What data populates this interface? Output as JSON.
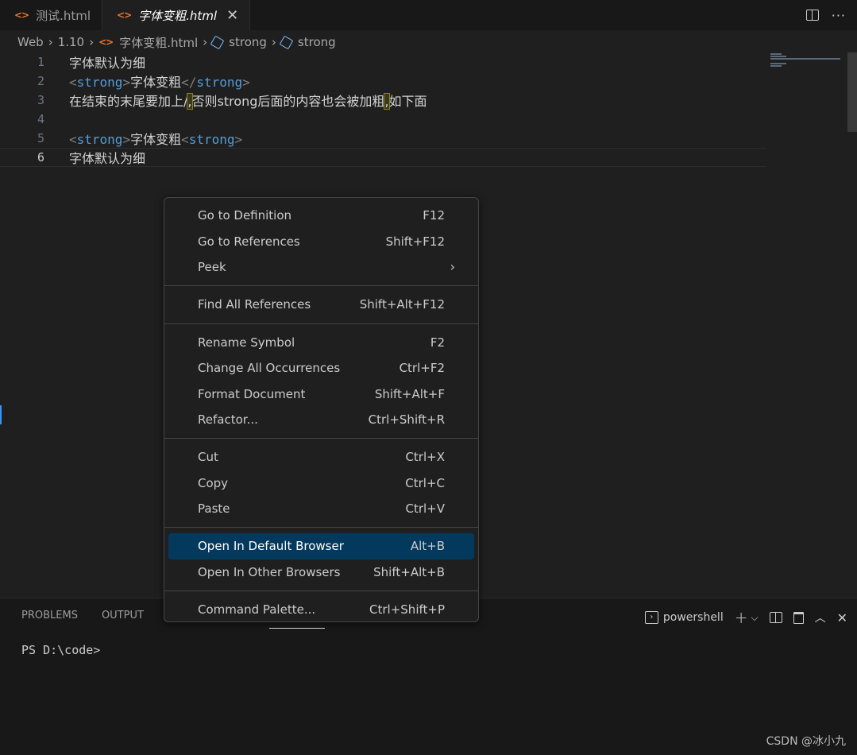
{
  "tabs": [
    {
      "label": "测试.html",
      "active": false
    },
    {
      "label": "字体变粗.html",
      "active": true
    }
  ],
  "breadcrumb": [
    "Web",
    "1.10",
    "字体变粗.html",
    "strong",
    "strong"
  ],
  "editor": {
    "lines": [
      {
        "n": "1"
      },
      {
        "n": "2"
      },
      {
        "n": "3"
      },
      {
        "n": "4"
      },
      {
        "n": "5"
      },
      {
        "n": "6"
      }
    ],
    "line1": "字体默认为细",
    "line2": {
      "open_lt": "<",
      "open_tag": "strong",
      "open_gt": ">",
      "text": "字体变粗",
      "close_lt": "</",
      "close_tag": "strong",
      "close_gt": ">"
    },
    "line3": {
      "a": "在结束的末尾要加上/",
      "b": ",",
      "c": "否则strong后面的内容也会被加粗",
      "d": ",",
      "e": "如下面"
    },
    "line5": {
      "open_lt": "<",
      "open_tag": "strong",
      "open_gt": ">",
      "text": "字体变粗",
      "close_lt": "<",
      "close_tag": "strong",
      "close_gt": ">"
    },
    "line6": "字体默认为细"
  },
  "context_menu": {
    "groups": [
      [
        {
          "label": "Go to Definition",
          "kb": "F12"
        },
        {
          "label": "Go to References",
          "kb": "Shift+F12"
        },
        {
          "label": "Peek",
          "kb": ""
        }
      ],
      [
        {
          "label": "Find All References",
          "kb": "Shift+Alt+F12"
        }
      ],
      [
        {
          "label": "Rename Symbol",
          "kb": "F2"
        },
        {
          "label": "Change All Occurrences",
          "kb": "Ctrl+F2"
        },
        {
          "label": "Format Document",
          "kb": "Shift+Alt+F"
        },
        {
          "label": "Refactor...",
          "kb": "Ctrl+Shift+R"
        }
      ],
      [
        {
          "label": "Cut",
          "kb": "Ctrl+X"
        },
        {
          "label": "Copy",
          "kb": "Ctrl+C"
        },
        {
          "label": "Paste",
          "kb": "Ctrl+V"
        }
      ],
      [
        {
          "label": "Open In Default Browser",
          "kb": "Alt+B"
        },
        {
          "label": "Open In Other Browsers",
          "kb": "Shift+Alt+B"
        }
      ],
      [
        {
          "label": "Command Palette...",
          "kb": "Ctrl+Shift+P"
        }
      ]
    ],
    "selected": "Open In Default Browser"
  },
  "panel": {
    "tabs": [
      "PROBLEMS",
      "OUTPUT"
    ],
    "terminal_name": "powershell",
    "prompt": "PS D:\\code>"
  },
  "watermark": "CSDN @冰小九",
  "colors": {
    "accent": "#04395e",
    "tag": "#569cd6",
    "html_icon": "#e37933"
  }
}
